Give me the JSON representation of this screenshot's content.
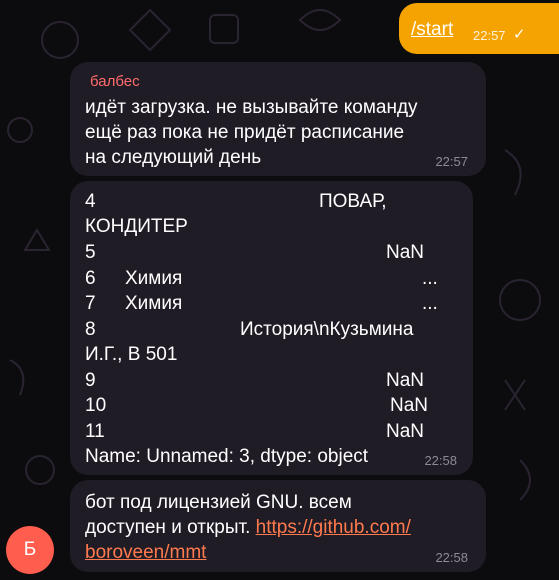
{
  "outgoing": {
    "text": "/start",
    "time": "22:57",
    "status_glyph": "✓"
  },
  "messages": [
    {
      "sender": "балбес",
      "lines": [
        "идёт загрузка. не вызывайте команду",
        "ещё раз пока не придёт расписание",
        "на следующий день"
      ],
      "time": "22:57"
    },
    {
      "rows": [
        [
          "4",
          "ПОВАР,"
        ],
        [
          "КОНДИТЕР",
          ""
        ],
        [
          "5",
          "NaN"
        ],
        [
          "6",
          "Химия",
          "..."
        ],
        [
          "7",
          "Химия",
          "..."
        ],
        [
          "8",
          "История\\nКузьмина"
        ],
        [
          "И.Г., В 501",
          ""
        ],
        [
          "9",
          "NaN"
        ],
        [
          "10",
          "NaN"
        ],
        [
          "11",
          "NaN"
        ]
      ],
      "footer": "Name: Unnamed: 3, dtype: object",
      "time": "22:58"
    },
    {
      "lines": [
        "бот под лицензией GNU. всем",
        "доступен и открыт."
      ],
      "link_part1": "https://github.com/",
      "link_part2": "boroveen/mmt",
      "time": "22:58"
    }
  ],
  "avatar_letter": "Б",
  "colors": {
    "background": "#0c0b0e",
    "bubble": "#201c26",
    "outgoing": "#f5a300",
    "sender_name": "#ff6b6b",
    "link": "#ff7a4d",
    "avatar": "#ff5d4d"
  }
}
